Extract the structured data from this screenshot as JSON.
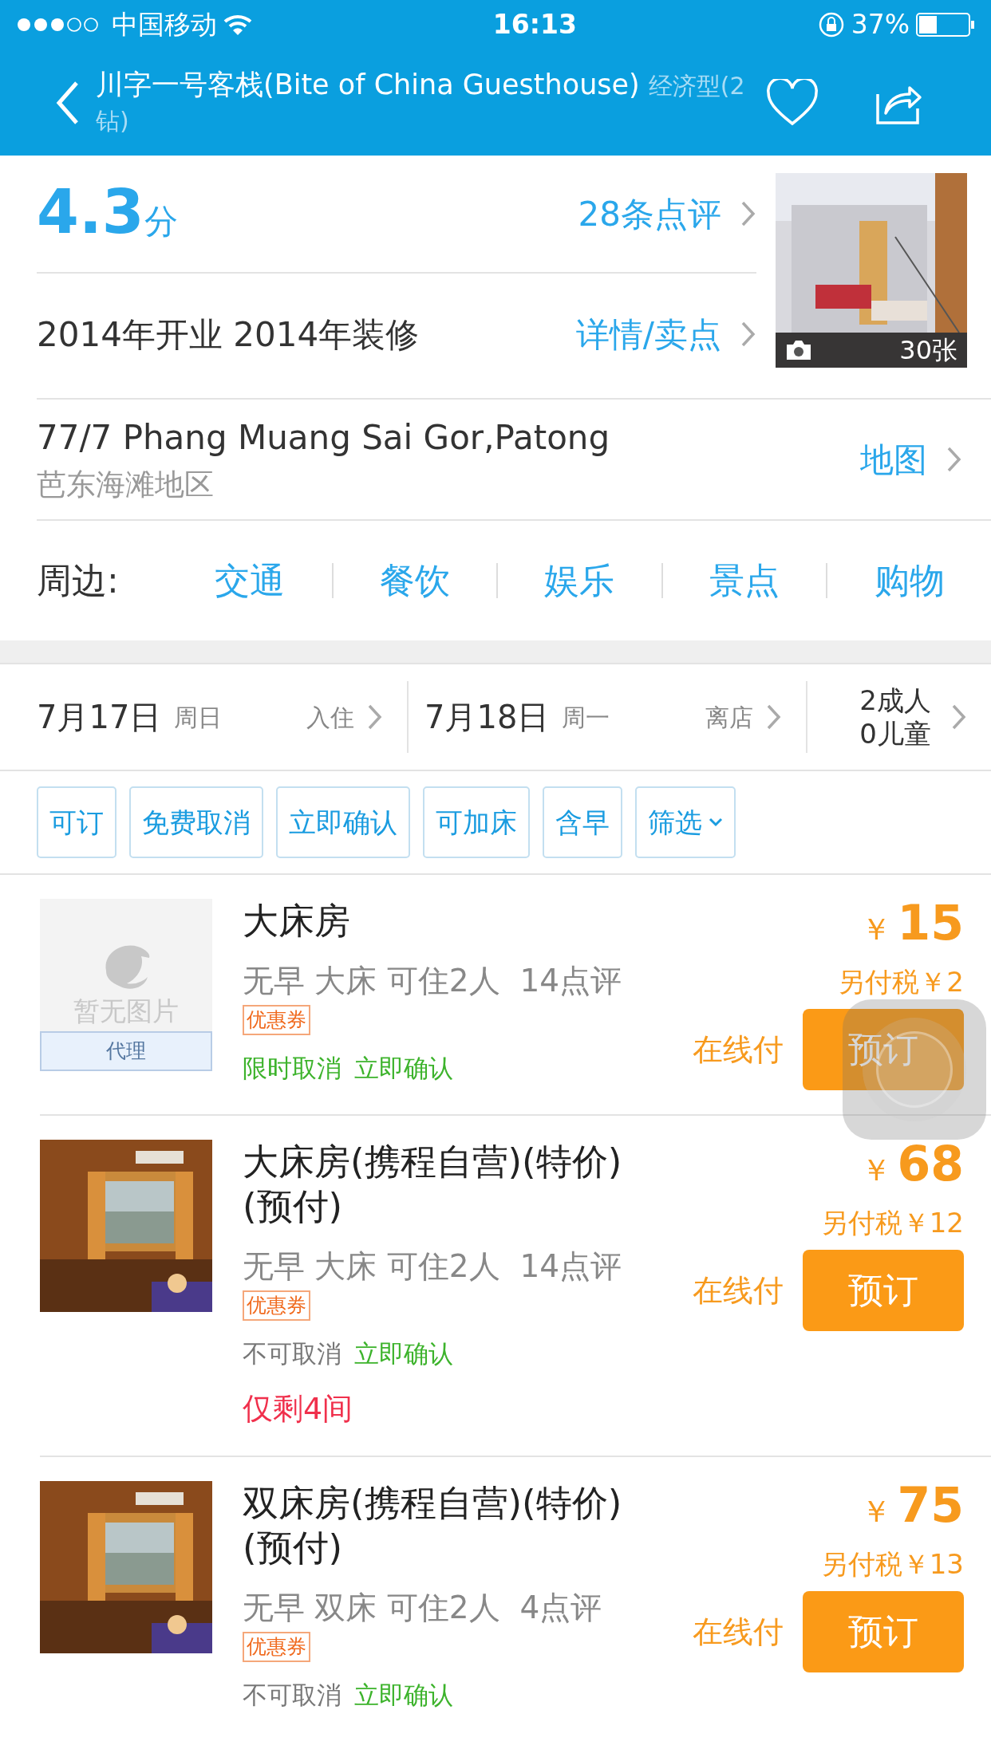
{
  "status_bar": {
    "carrier": "中国移动",
    "time": "16:13",
    "battery": "37%"
  },
  "header": {
    "title": "川字一号客栈(Bite of China Guesthouse)",
    "grade": "经济型(2钻)"
  },
  "rating": {
    "score": "4.3",
    "unit": "分",
    "reviews": "28条点评"
  },
  "opening": {
    "text": "2014年开业 2014年装修",
    "link": "详情/卖点"
  },
  "photo": {
    "count": "30张"
  },
  "address": {
    "line": "77/7 Phang Muang Sai Gor,Patong",
    "area": "芭东海滩地区",
    "link": "地图"
  },
  "nearby": {
    "label": "周边:",
    "items": [
      "交通",
      "餐饮",
      "娱乐",
      "景点",
      "购物"
    ]
  },
  "dates": {
    "checkin": {
      "date": "7月17日",
      "weekday": "周日",
      "action": "入住"
    },
    "checkout": {
      "date": "7月18日",
      "weekday": "周一",
      "action": "离店"
    },
    "guests": [
      "2成人",
      "0儿童"
    ]
  },
  "filters": [
    {
      "label": "可订",
      "kind": "chip"
    },
    {
      "label": "免费取消",
      "kind": "chip"
    },
    {
      "label": "立即确认",
      "kind": "chip"
    },
    {
      "label": "可加床",
      "kind": "chip"
    },
    {
      "label": "含早",
      "kind": "chip"
    },
    {
      "label": "筛选",
      "kind": "dropdown"
    }
  ],
  "rooms": [
    {
      "image": {
        "kind": "placeholder",
        "text": "暂无图片",
        "badge": "代理"
      },
      "name": "大床房",
      "details": "无早 大床 可住2人  14点评",
      "coupon": "优惠券",
      "conditions": [
        {
          "text": "限时取消",
          "kind": "positive"
        },
        {
          "text": "立即确认",
          "kind": "positive"
        }
      ],
      "price_symbol": "￥",
      "price": "15",
      "tax": "另付税￥2",
      "payment": "在线付",
      "book": "预订"
    },
    {
      "image": {
        "kind": "picture"
      },
      "name": "大床房(携程自营)(特价)(预付)",
      "details": "无早 大床 可住2人  14点评",
      "coupon": "优惠券",
      "conditions": [
        {
          "text": "不可取消",
          "kind": "neutral"
        },
        {
          "text": "立即确认",
          "kind": "positive"
        }
      ],
      "notice": "仅剩4间",
      "price_symbol": "￥",
      "price": "68",
      "tax": "另付税￥12",
      "payment": "在线付",
      "book": "预订"
    },
    {
      "image": {
        "kind": "picture"
      },
      "name": "双床房(携程自营)(特价)(预付)",
      "details": "无早 双床 可住2人  4点评",
      "coupon": "优惠券",
      "conditions": [
        {
          "text": "不可取消",
          "kind": "neutral"
        },
        {
          "text": "立即确认",
          "kind": "positive"
        }
      ],
      "price_symbol": "￥",
      "price": "75",
      "tax": "另付税￥13",
      "payment": "在线付",
      "book": "预订"
    }
  ],
  "assistive_touch": {
    "shown": true
  }
}
